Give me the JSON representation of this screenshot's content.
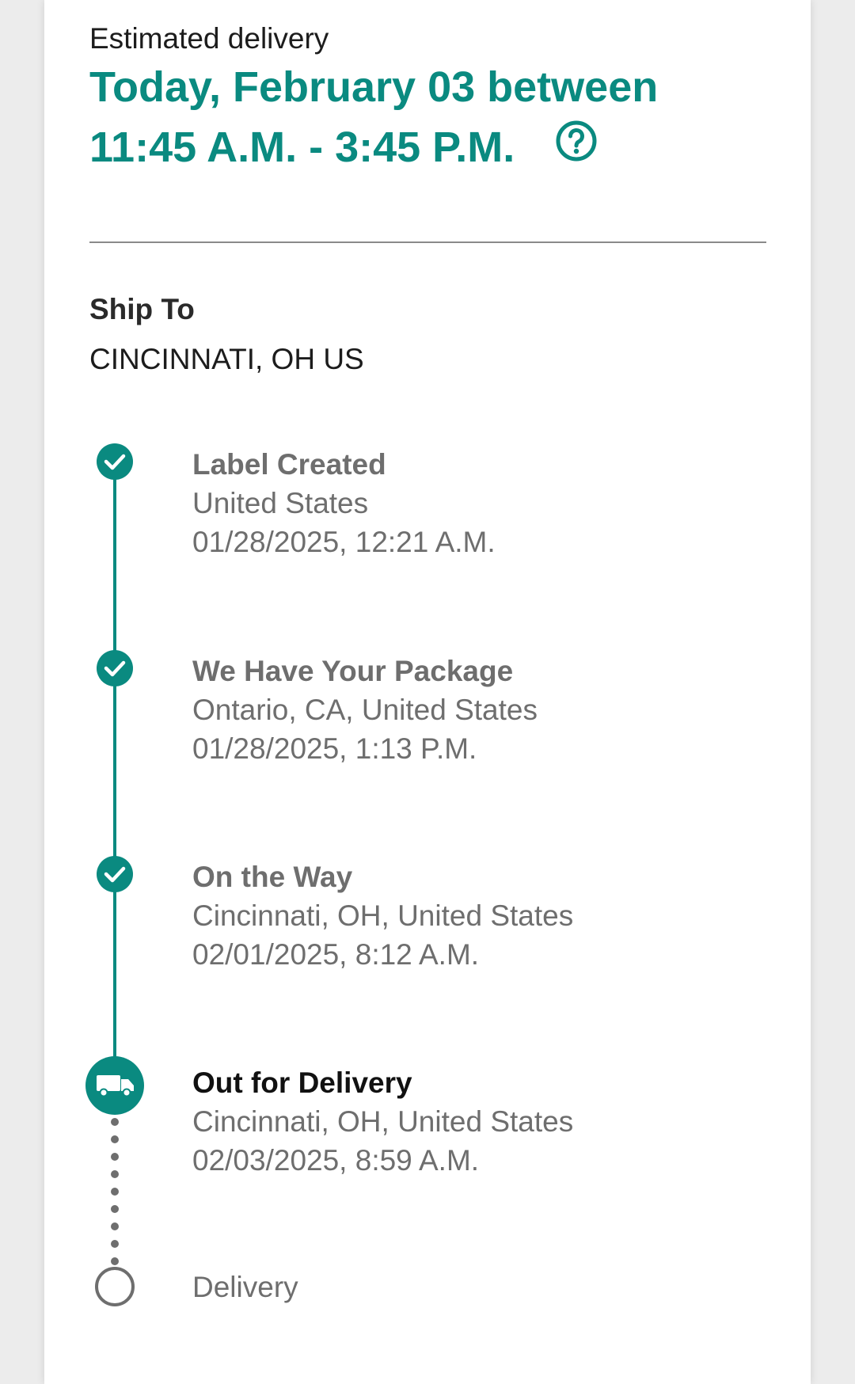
{
  "estimated": {
    "label": "Estimated delivery",
    "line1": "Today, February 03 between",
    "line2": "11:45 A.M. - 3:45 P.M."
  },
  "ship_to": {
    "label": "Ship To",
    "value": "CINCINNATI, OH US"
  },
  "events": [
    {
      "title": "Label Created",
      "location": "United States",
      "datetime": "01/28/2025, 12:21 A.M.",
      "status": "done"
    },
    {
      "title": "We Have Your Package",
      "location": "Ontario, CA, United States",
      "datetime": "01/28/2025, 1:13 P.M.",
      "status": "done"
    },
    {
      "title": "On the Way",
      "location": "Cincinnati, OH, United States",
      "datetime": "02/01/2025, 8:12 A.M.",
      "status": "done"
    },
    {
      "title": "Out for Delivery",
      "location": "Cincinnati, OH, United States",
      "datetime": "02/03/2025, 8:59 A.M.",
      "status": "current"
    },
    {
      "title": "Delivery",
      "status": "pending"
    }
  ],
  "icons": {
    "help": "question-circle-icon",
    "done": "check-circle-icon",
    "current": "delivery-truck-icon",
    "pending": "empty-circle-icon"
  },
  "colors": {
    "accent": "#0a8a80",
    "text": "#1c1c1c",
    "muted": "#6e6e6e",
    "divider": "#8a8a8a",
    "background": "#ececec",
    "card": "#ffffff"
  }
}
